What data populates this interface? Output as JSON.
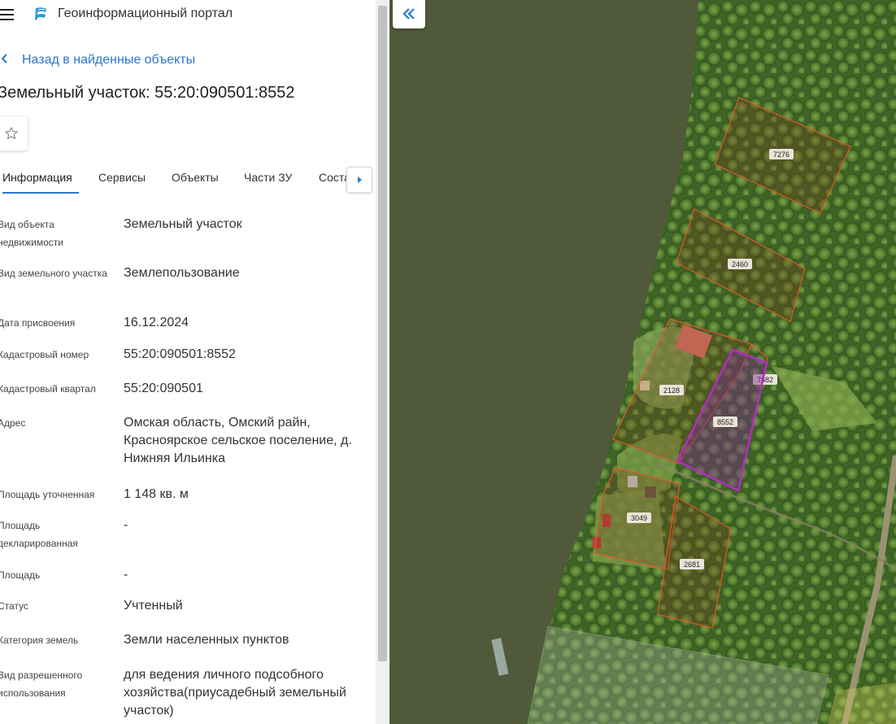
{
  "header": {
    "app_title": "Геоинформационный портал"
  },
  "nav": {
    "back_label": "Назад в найденные объекты"
  },
  "object": {
    "title": "Земельный участок: 55:20:090501:8552"
  },
  "tabs": [
    {
      "label": "Информация",
      "active": true
    },
    {
      "label": "Сервисы"
    },
    {
      "label": "Объекты"
    },
    {
      "label": "Части ЗУ"
    },
    {
      "label": "Соста"
    }
  ],
  "info": [
    {
      "label": "Вид объекта недвижимости",
      "value": "Земельный участок"
    },
    {
      "label": "Вид земельного участка",
      "value": "Землепользование"
    },
    {
      "label": "Дата присвоения",
      "value": "16.12.2024"
    },
    {
      "label": "Кадастровый номер",
      "value": "55:20:090501:8552"
    },
    {
      "label": "Кадастровый квартал",
      "value": "55:20:090501"
    },
    {
      "label": "Адрес",
      "value": "Омская область, Омский райн, Красноярское сельское поселение, д. Нижняя Ильинка"
    },
    {
      "label": "Площадь уточненная",
      "value": "1 148 кв. м"
    },
    {
      "label": "Площадь декларированная",
      "value": "-"
    },
    {
      "label": "Площадь",
      "value": "-"
    },
    {
      "label": "Статус",
      "value": "Учтенный"
    },
    {
      "label": "Категория земель",
      "value": "Земли населенных пунктов"
    },
    {
      "label": "Вид разрешенного использования",
      "value": "для ведения личного подсобного хозяйства(приусадебный земельный участок)"
    }
  ],
  "map": {
    "parcels": [
      {
        "number": "7276"
      },
      {
        "number": "2460"
      },
      {
        "number": "2128"
      },
      {
        "number": "7882"
      },
      {
        "number": "8552",
        "selected": true
      },
      {
        "number": "3049"
      },
      {
        "number": "2681"
      }
    ]
  },
  "colors": {
    "accent": "#2a76c8",
    "parcel_border": "#d9542c",
    "selected_parcel": "#b52cc4"
  },
  "icons": [
    "menu-icon",
    "portal-logo-icon",
    "chevron-left-icon",
    "star-icon",
    "chevron-right-icon",
    "double-chevron-left-icon"
  ]
}
